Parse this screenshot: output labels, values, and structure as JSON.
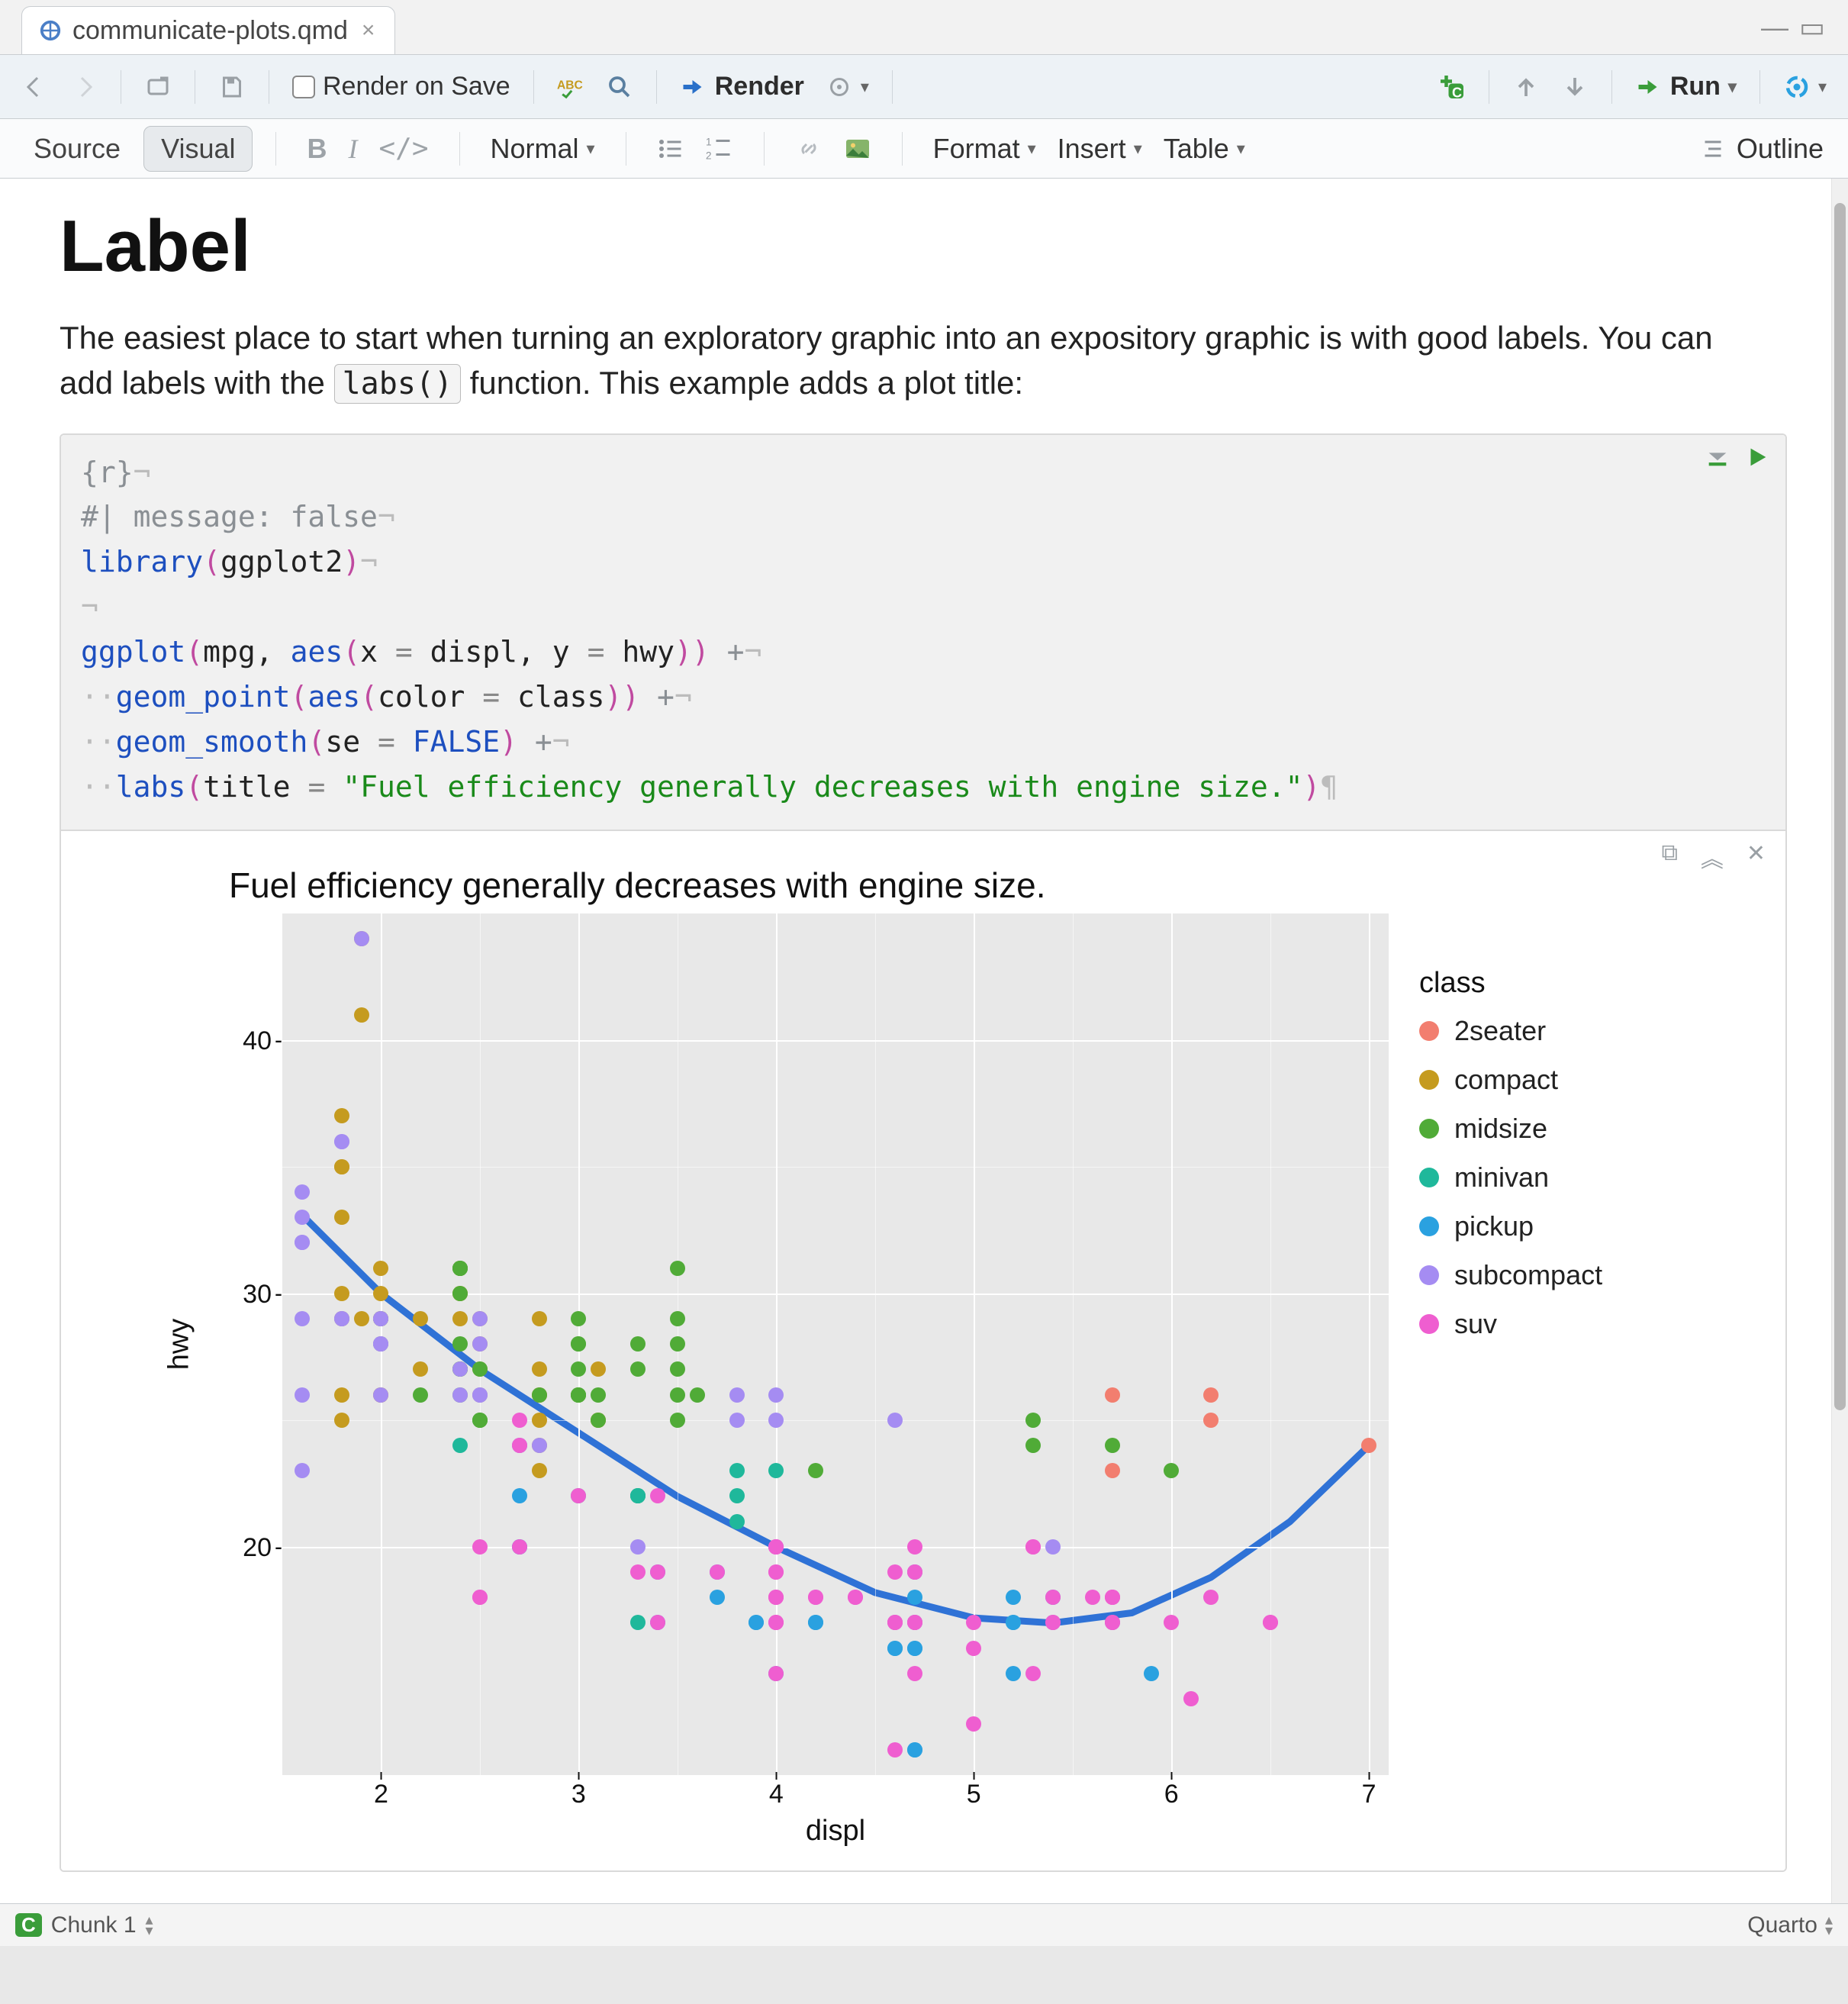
{
  "tab": {
    "filename": "communicate-plots.qmd"
  },
  "toolbar": {
    "render_on_save": "Render on Save",
    "render": "Render",
    "run": "Run"
  },
  "viewbar": {
    "source": "Source",
    "visual": "Visual",
    "style_select": "Normal",
    "format": "Format",
    "insert": "Insert",
    "table": "Table",
    "outline": "Outline"
  },
  "doc": {
    "heading": "Label",
    "para_a": "The easiest place to start when turning an exploratory graphic into an expository graphic is with good labels. You can add labels with the ",
    "inline_code": "labs()",
    "para_b": " function. This example adds a plot title:"
  },
  "code": {
    "spec": "{r}",
    "comment": "#| message: false",
    "lib_fn": "library",
    "lib_arg": "ggplot2",
    "gg_fn": "ggplot",
    "gg_args_a": "mpg",
    "aes_fn": "aes",
    "aes_x": "x",
    "aes_xv": "displ",
    "aes_y": "y",
    "aes_yv": "hwy",
    "gp_fn": "geom_point",
    "gp_color": "color",
    "gp_colorv": "class",
    "gs_fn": "geom_smooth",
    "gs_se": "se",
    "gs_sev": "FALSE",
    "labs_fn": "labs",
    "labs_title": "title",
    "labs_titlev": "\"Fuel efficiency generally decreases with engine size.\""
  },
  "chart_data": {
    "type": "scatter",
    "title": "Fuel efficiency generally decreases with engine size.",
    "xlabel": "displ",
    "ylabel": "hwy",
    "xlim": [
      1.5,
      7.1
    ],
    "ylim": [
      11,
      45
    ],
    "xticks": [
      2,
      3,
      4,
      5,
      6,
      7
    ],
    "yticks": [
      20,
      30,
      40
    ],
    "legend_title": "class",
    "colors": {
      "2seater": "#f27e6f",
      "compact": "#c59b1f",
      "midsize": "#50ab37",
      "minivan": "#1fb89b",
      "pickup": "#2aa1e0",
      "subcompact": "#a58cf2",
      "suv": "#ef5ed0"
    },
    "series": [
      {
        "name": "2seater",
        "points": [
          [
            5.7,
            26
          ],
          [
            5.7,
            23
          ],
          [
            6.2,
            26
          ],
          [
            6.2,
            25
          ],
          [
            7.0,
            24
          ]
        ]
      },
      {
        "name": "compact",
        "points": [
          [
            1.8,
            29
          ],
          [
            1.8,
            29
          ],
          [
            2.0,
            31
          ],
          [
            2.0,
            30
          ],
          [
            2.8,
            26
          ],
          [
            2.8,
            26
          ],
          [
            3.1,
            27
          ],
          [
            1.8,
            26
          ],
          [
            1.8,
            25
          ],
          [
            2.0,
            28
          ],
          [
            2.0,
            29
          ],
          [
            2.8,
            27
          ],
          [
            2.8,
            25
          ],
          [
            3.1,
            25
          ],
          [
            3.1,
            25
          ],
          [
            2.4,
            30
          ],
          [
            2.4,
            30
          ],
          [
            2.5,
            26
          ],
          [
            2.5,
            27
          ],
          [
            2.2,
            27
          ],
          [
            2.2,
            29
          ],
          [
            2.4,
            31
          ],
          [
            2.4,
            31
          ],
          [
            3.0,
            26
          ],
          [
            1.8,
            30
          ],
          [
            1.8,
            33
          ],
          [
            1.8,
            35
          ],
          [
            1.8,
            37
          ],
          [
            1.8,
            35
          ],
          [
            2.4,
            29
          ],
          [
            2.4,
            27
          ],
          [
            3.3,
            22
          ],
          [
            2.0,
            26
          ],
          [
            2.0,
            29
          ],
          [
            2.0,
            29
          ],
          [
            2.0,
            29
          ],
          [
            2.8,
            24
          ],
          [
            1.9,
            44
          ],
          [
            2.0,
            29
          ],
          [
            2.0,
            26
          ],
          [
            2.5,
            28
          ],
          [
            2.5,
            29
          ],
          [
            2.8,
            29
          ],
          [
            2.8,
            23
          ],
          [
            1.9,
            29
          ],
          [
            1.9,
            41
          ]
        ]
      },
      {
        "name": "midsize",
        "points": [
          [
            2.8,
            26
          ],
          [
            3.1,
            25
          ],
          [
            4.2,
            23
          ],
          [
            5.3,
            25
          ],
          [
            5.3,
            24
          ],
          [
            5.7,
            24
          ],
          [
            6.0,
            23
          ],
          [
            2.4,
            27
          ],
          [
            2.4,
            30
          ],
          [
            3.1,
            26
          ],
          [
            3.5,
            29
          ],
          [
            3.6,
            26
          ],
          [
            2.4,
            26
          ],
          [
            2.4,
            27
          ],
          [
            2.4,
            28
          ],
          [
            2.4,
            27
          ],
          [
            2.5,
            25
          ],
          [
            2.5,
            25
          ],
          [
            3.3,
            27
          ],
          [
            2.5,
            27
          ],
          [
            2.5,
            25
          ],
          [
            3.5,
            25
          ],
          [
            3.0,
            26
          ],
          [
            3.3,
            28
          ],
          [
            3.0,
            26
          ],
          [
            3.0,
            28
          ],
          [
            3.0,
            27
          ],
          [
            3.0,
            29
          ],
          [
            2.4,
            31
          ],
          [
            2.4,
            31
          ],
          [
            2.4,
            31
          ],
          [
            2.4,
            31
          ],
          [
            3.0,
            26
          ],
          [
            3.5,
            28
          ],
          [
            3.5,
            27
          ],
          [
            3.5,
            31
          ],
          [
            2.0,
            28
          ],
          [
            2.0,
            29
          ],
          [
            2.2,
            26
          ],
          [
            3.0,
            26
          ],
          [
            3.0,
            28
          ],
          [
            3.5,
            26
          ]
        ]
      },
      {
        "name": "minivan",
        "points": [
          [
            2.4,
            24
          ],
          [
            3.0,
            22
          ],
          [
            3.3,
            22
          ],
          [
            3.3,
            22
          ],
          [
            3.3,
            22
          ],
          [
            3.3,
            17
          ],
          [
            3.3,
            22
          ],
          [
            3.8,
            22
          ],
          [
            3.8,
            21
          ],
          [
            3.8,
            23
          ],
          [
            4.0,
            23
          ]
        ]
      },
      {
        "name": "pickup",
        "points": [
          [
            3.7,
            19
          ],
          [
            3.7,
            18
          ],
          [
            3.9,
            17
          ],
          [
            3.9,
            17
          ],
          [
            4.7,
            19
          ],
          [
            4.7,
            19
          ],
          [
            4.7,
            12
          ],
          [
            5.2,
            17
          ],
          [
            5.2,
            15
          ],
          [
            5.7,
            17
          ],
          [
            5.9,
            15
          ],
          [
            4.7,
            16
          ],
          [
            4.7,
            12
          ],
          [
            4.7,
            17
          ],
          [
            4.7,
            17
          ],
          [
            4.7,
            16
          ],
          [
            4.7,
            18
          ],
          [
            5.2,
            18
          ],
          [
            5.2,
            17
          ],
          [
            4.2,
            17
          ],
          [
            4.2,
            17
          ],
          [
            4.6,
            16
          ],
          [
            4.6,
            16
          ],
          [
            4.6,
            17
          ],
          [
            5.4,
            17
          ],
          [
            5.4,
            18
          ],
          [
            2.7,
            20
          ],
          [
            2.7,
            20
          ],
          [
            2.7,
            22
          ],
          [
            3.4,
            17
          ],
          [
            3.4,
            19
          ],
          [
            4.0,
            20
          ],
          [
            4.0,
            15
          ]
        ]
      },
      {
        "name": "subcompact",
        "points": [
          [
            3.8,
            26
          ],
          [
            3.8,
            25
          ],
          [
            4.0,
            26
          ],
          [
            4.0,
            25
          ],
          [
            4.6,
            25
          ],
          [
            5.4,
            20
          ],
          [
            1.6,
            33
          ],
          [
            1.6,
            32
          ],
          [
            1.6,
            32
          ],
          [
            1.6,
            29
          ],
          [
            1.6,
            34
          ],
          [
            1.8,
            36
          ],
          [
            1.8,
            36
          ],
          [
            2.0,
            29
          ],
          [
            2.4,
            26
          ],
          [
            2.4,
            27
          ],
          [
            2.5,
            26
          ],
          [
            2.5,
            26
          ],
          [
            3.3,
            20
          ],
          [
            1.6,
            23
          ],
          [
            1.6,
            26
          ],
          [
            2.0,
            28
          ],
          [
            2.0,
            29
          ],
          [
            2.7,
            24
          ],
          [
            2.7,
            24
          ],
          [
            2.7,
            24
          ],
          [
            1.9,
            44
          ],
          [
            2.0,
            26
          ],
          [
            2.5,
            28
          ],
          [
            2.5,
            29
          ],
          [
            1.8,
            29
          ],
          [
            1.8,
            29
          ],
          [
            2.0,
            28
          ],
          [
            2.0,
            28
          ],
          [
            2.8,
            24
          ]
        ]
      },
      {
        "name": "suv",
        "points": [
          [
            5.3,
            20
          ],
          [
            5.3,
            15
          ],
          [
            5.3,
            20
          ],
          [
            5.7,
            17
          ],
          [
            6.0,
            17
          ],
          [
            5.7,
            18
          ],
          [
            5.7,
            17
          ],
          [
            6.2,
            18
          ],
          [
            4.0,
            17
          ],
          [
            4.0,
            17
          ],
          [
            4.0,
            18
          ],
          [
            4.0,
            17
          ],
          [
            4.6,
            17
          ],
          [
            5.0,
            17
          ],
          [
            4.2,
            18
          ],
          [
            4.4,
            18
          ],
          [
            4.6,
            17
          ],
          [
            5.4,
            17
          ],
          [
            5.4,
            18
          ],
          [
            2.5,
            18
          ],
          [
            2.5,
            18
          ],
          [
            2.7,
            20
          ],
          [
            3.4,
            19
          ],
          [
            3.4,
            17
          ],
          [
            4.0,
            20
          ],
          [
            4.7,
            17
          ],
          [
            5.7,
            18
          ],
          [
            6.5,
            17
          ],
          [
            2.7,
            25
          ],
          [
            2.7,
            24
          ],
          [
            3.4,
            22
          ],
          [
            4.0,
            20
          ],
          [
            4.7,
            20
          ],
          [
            4.7,
            17
          ],
          [
            4.7,
            15
          ],
          [
            6.1,
            14
          ],
          [
            4.0,
            18
          ],
          [
            4.2,
            18
          ],
          [
            4.4,
            18
          ],
          [
            4.6,
            17
          ],
          [
            5.4,
            17
          ],
          [
            4.0,
            19
          ],
          [
            2.5,
            20
          ],
          [
            4.0,
            18
          ],
          [
            4.6,
            19
          ],
          [
            5.0,
            16
          ],
          [
            3.0,
            22
          ],
          [
            3.7,
            19
          ],
          [
            4.0,
            20
          ],
          [
            4.7,
            17
          ],
          [
            4.7,
            19
          ],
          [
            4.7,
            19
          ],
          [
            5.7,
            18
          ],
          [
            6.5,
            17
          ],
          [
            4.0,
            19
          ],
          [
            4.0,
            15
          ],
          [
            4.0,
            20
          ],
          [
            4.6,
            12
          ],
          [
            5.0,
            13
          ],
          [
            3.3,
            19
          ],
          [
            4.0,
            20
          ],
          [
            5.6,
            18
          ]
        ]
      }
    ],
    "smooth_line": [
      [
        1.6,
        33.1
      ],
      [
        2.0,
        30.0
      ],
      [
        2.5,
        27.0
      ],
      [
        3.0,
        24.5
      ],
      [
        3.5,
        22.0
      ],
      [
        4.0,
        20.0
      ],
      [
        4.5,
        18.2
      ],
      [
        5.0,
        17.2
      ],
      [
        5.4,
        17.0
      ],
      [
        5.8,
        17.4
      ],
      [
        6.2,
        18.8
      ],
      [
        6.6,
        21.0
      ],
      [
        7.0,
        24.0
      ]
    ]
  },
  "status": {
    "chunk": "Chunk 1",
    "engine": "Quarto"
  }
}
